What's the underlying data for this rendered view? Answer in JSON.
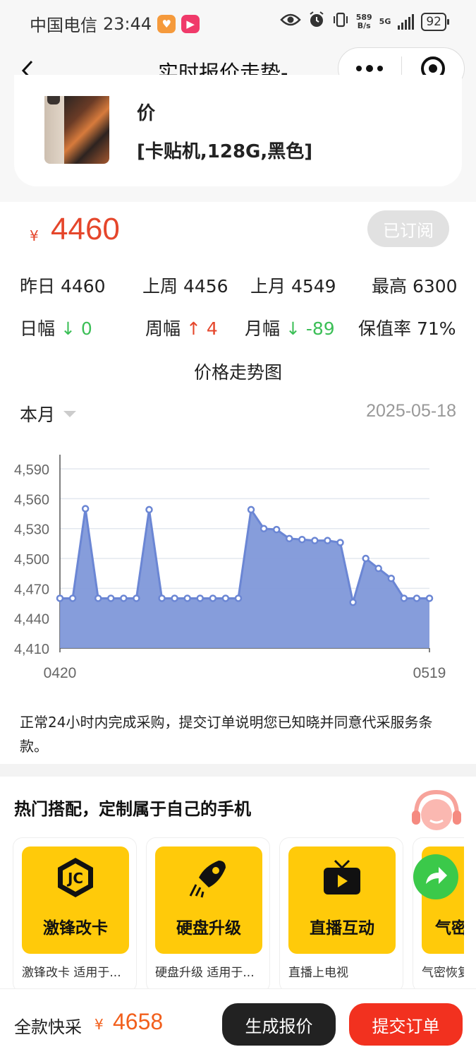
{
  "status_bar": {
    "carrier": "中国电信",
    "time": "23:44",
    "net_speed_value": "589",
    "net_speed_unit": "B/s",
    "network": "5G",
    "battery": "92"
  },
  "nav": {
    "title": "实时报价走势-..."
  },
  "product": {
    "name_tail": "价",
    "spec": "[卡贴机,128G,黑色]"
  },
  "price": {
    "currency": "¥",
    "current": "4460",
    "subscribe_label": "已订阅"
  },
  "stats": {
    "yesterday_label": "昨日",
    "yesterday": "4460",
    "last_week_label": "上周",
    "last_week": "4456",
    "last_month_label": "上月",
    "last_month": "4549",
    "highest_label": "最高",
    "highest": "6300",
    "day_change_label": "日幅",
    "day_change_arrow": "↓",
    "day_change": "0",
    "week_change_label": "周幅",
    "week_change_arrow": "↑",
    "week_change": "4",
    "month_change_label": "月幅",
    "month_change_arrow": "↓",
    "month_change": "-89",
    "retention_label": "保值率",
    "retention": "71%"
  },
  "chart_section": {
    "title": "价格走势图",
    "range": "本月",
    "date": "2025-05-18"
  },
  "chart_data": {
    "type": "area",
    "x_start": "0420",
    "x_end": "0519",
    "y_ticks": [
      "4,410",
      "4,440",
      "4,470",
      "4,500",
      "4,530",
      "4,560",
      "4,590"
    ],
    "ylim": [
      4410,
      4600
    ],
    "values": [
      4460,
      4460,
      4550,
      4460,
      4460,
      4460,
      4460,
      4549,
      4460,
      4460,
      4460,
      4460,
      4460,
      4460,
      4460,
      4549,
      4530,
      4529,
      4520,
      4519,
      4518,
      4518,
      4516,
      4456,
      4500,
      4490,
      4480,
      4460,
      4460,
      4460
    ],
    "series_color": "#6b86d4",
    "fill_color": "#8098d9",
    "grid": true
  },
  "notice": "正常24小时内完成采购，提交订单说明您已知晓并同意代采服务条款。",
  "hot": {
    "title": "热门搭配，定制属于自己的手机",
    "cards": [
      {
        "img_text": "激锋改卡",
        "desc": "激锋改卡 适用于..."
      },
      {
        "img_text": "硬盘升级",
        "desc": "硬盘升级 适用于..."
      },
      {
        "img_text": "直播互动",
        "desc": "直播上电视"
      },
      {
        "img_text": "气密",
        "desc": "气密恢复"
      }
    ]
  },
  "bottom": {
    "label": "全款快采",
    "currency": "¥",
    "price": "4658",
    "quote_button": "生成报价",
    "submit_button": "提交订单"
  }
}
